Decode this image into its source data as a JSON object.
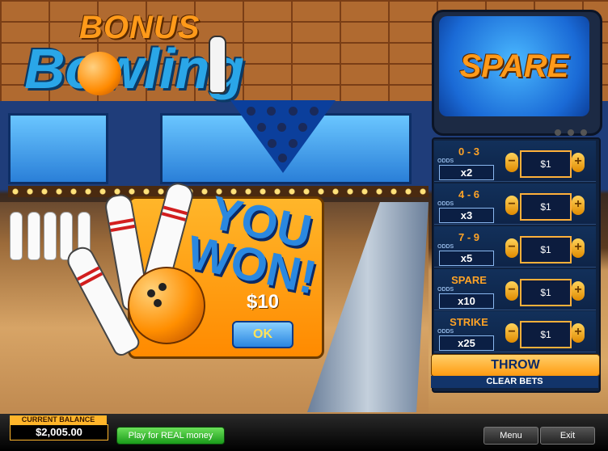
{
  "logo": {
    "bonus": "BONUS",
    "bowling": "Bowling"
  },
  "tv": {
    "status": "SPARE"
  },
  "popup": {
    "title": "YOU WON!",
    "amount": "$10",
    "ok_label": "OK"
  },
  "bets": [
    {
      "range": "0 - 3",
      "odds_label": "ODDS",
      "multiplier": "x2",
      "amount": "$1"
    },
    {
      "range": "4 - 6",
      "odds_label": "ODDS",
      "multiplier": "x3",
      "amount": "$1"
    },
    {
      "range": "7 - 9",
      "odds_label": "ODDS",
      "multiplier": "x5",
      "amount": "$1"
    },
    {
      "range": "SPARE",
      "odds_label": "ODDS",
      "multiplier": "x10",
      "amount": "$1"
    },
    {
      "range": "STRIKE",
      "odds_label": "ODDS",
      "multiplier": "x25",
      "amount": "$1"
    }
  ],
  "controls": {
    "throw_label": "THROW",
    "clear_label": "CLEAR BETS",
    "minus": "−",
    "plus": "+"
  },
  "footer": {
    "balance_label": "CURRENT BALANCE",
    "balance_value": "$2,005.00",
    "real_money_label": "Play for REAL money",
    "menu_label": "Menu",
    "exit_label": "Exit"
  },
  "colors": {
    "accent": "#ff9a1a",
    "primary_blue": "#2a88e0",
    "panel": "#10223f"
  }
}
